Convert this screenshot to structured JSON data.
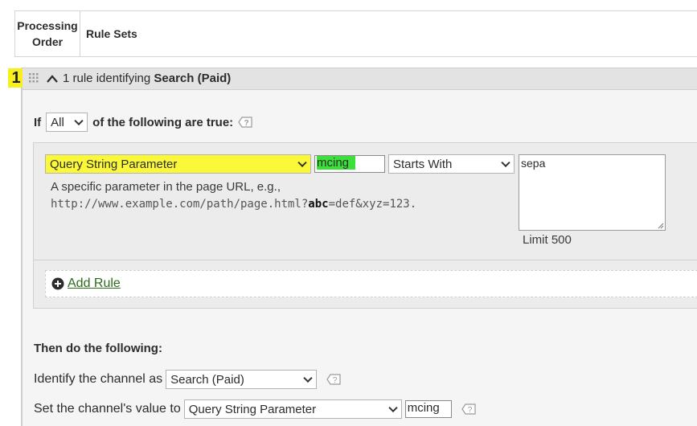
{
  "header": {
    "order_label_line1": "Processing",
    "order_label_line2": "Order",
    "rule_sets_label": "Rule Sets"
  },
  "ruleset": {
    "order_number": "1",
    "title_prefix": "1 rule identifying ",
    "title_channel": "Search (Paid)"
  },
  "conditions": {
    "if_label": "If",
    "match_value": "All",
    "suffix_label": "of the following are true:"
  },
  "rule": {
    "type_value": "Query String Parameter",
    "param_value": "mcing",
    "operator_value": "Starts With",
    "match_text": "sepa",
    "description": "A specific parameter in the page URL, e.g.,",
    "example_prefix": "http://www.example.com/path/page.html?",
    "example_bold": "abc",
    "example_suffix": "=def&xyz=123.",
    "limit_label": "Limit 500"
  },
  "add_rule_label": "Add Rule",
  "actions": {
    "then_label": "Then do the following:",
    "identify_label": "Identify the channel as",
    "identify_value": "Search (Paid)",
    "set_value_label": "Set the channel's value to",
    "set_value_type": "Query String Parameter",
    "set_value_param": "mcing"
  },
  "colors": {
    "highlight_yellow": "#fbf83a",
    "highlight_green": "#3be03b",
    "link_green": "#2d6a1b"
  }
}
